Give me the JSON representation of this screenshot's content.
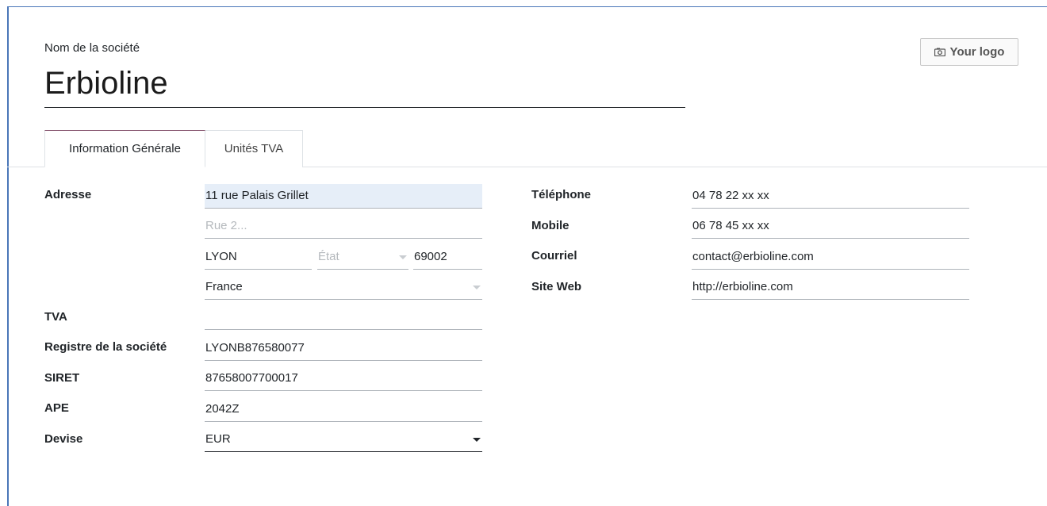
{
  "company": {
    "label": "Nom de la société",
    "name": "Erbioline"
  },
  "logo_button": {
    "label": "Your logo",
    "icon": "camera-icon"
  },
  "tabs": [
    {
      "label": "Information Générale",
      "active": true
    },
    {
      "label": "Unités TVA",
      "active": false
    }
  ],
  "address": {
    "label": "Adresse",
    "street": "11 rue Palais Grillet",
    "street2_placeholder": "Rue 2...",
    "city": "LYON",
    "state_placeholder": "État",
    "zip": "69002",
    "country": "France"
  },
  "tva": {
    "label": "TVA",
    "value": ""
  },
  "registry": {
    "label": "Registre de la société",
    "value": "LYONB876580077"
  },
  "siret": {
    "label": "SIRET",
    "value": "87658007700017"
  },
  "ape": {
    "label": "APE",
    "value": "2042Z"
  },
  "currency": {
    "label": "Devise",
    "value": "EUR"
  },
  "contact": {
    "phone": {
      "label": "Téléphone",
      "value": "04 78 22 xx xx"
    },
    "mobile": {
      "label": "Mobile",
      "value": "06 78 45 xx xx"
    },
    "email": {
      "label": "Courriel",
      "value": "contact@erbioline.com"
    },
    "website": {
      "label": "Site Web",
      "value": "http://erbioline.com"
    }
  },
  "colors": {
    "frame": "#4a76b8",
    "focused_field": "#e6eef8",
    "active_tab_top": "#8a5a73"
  }
}
